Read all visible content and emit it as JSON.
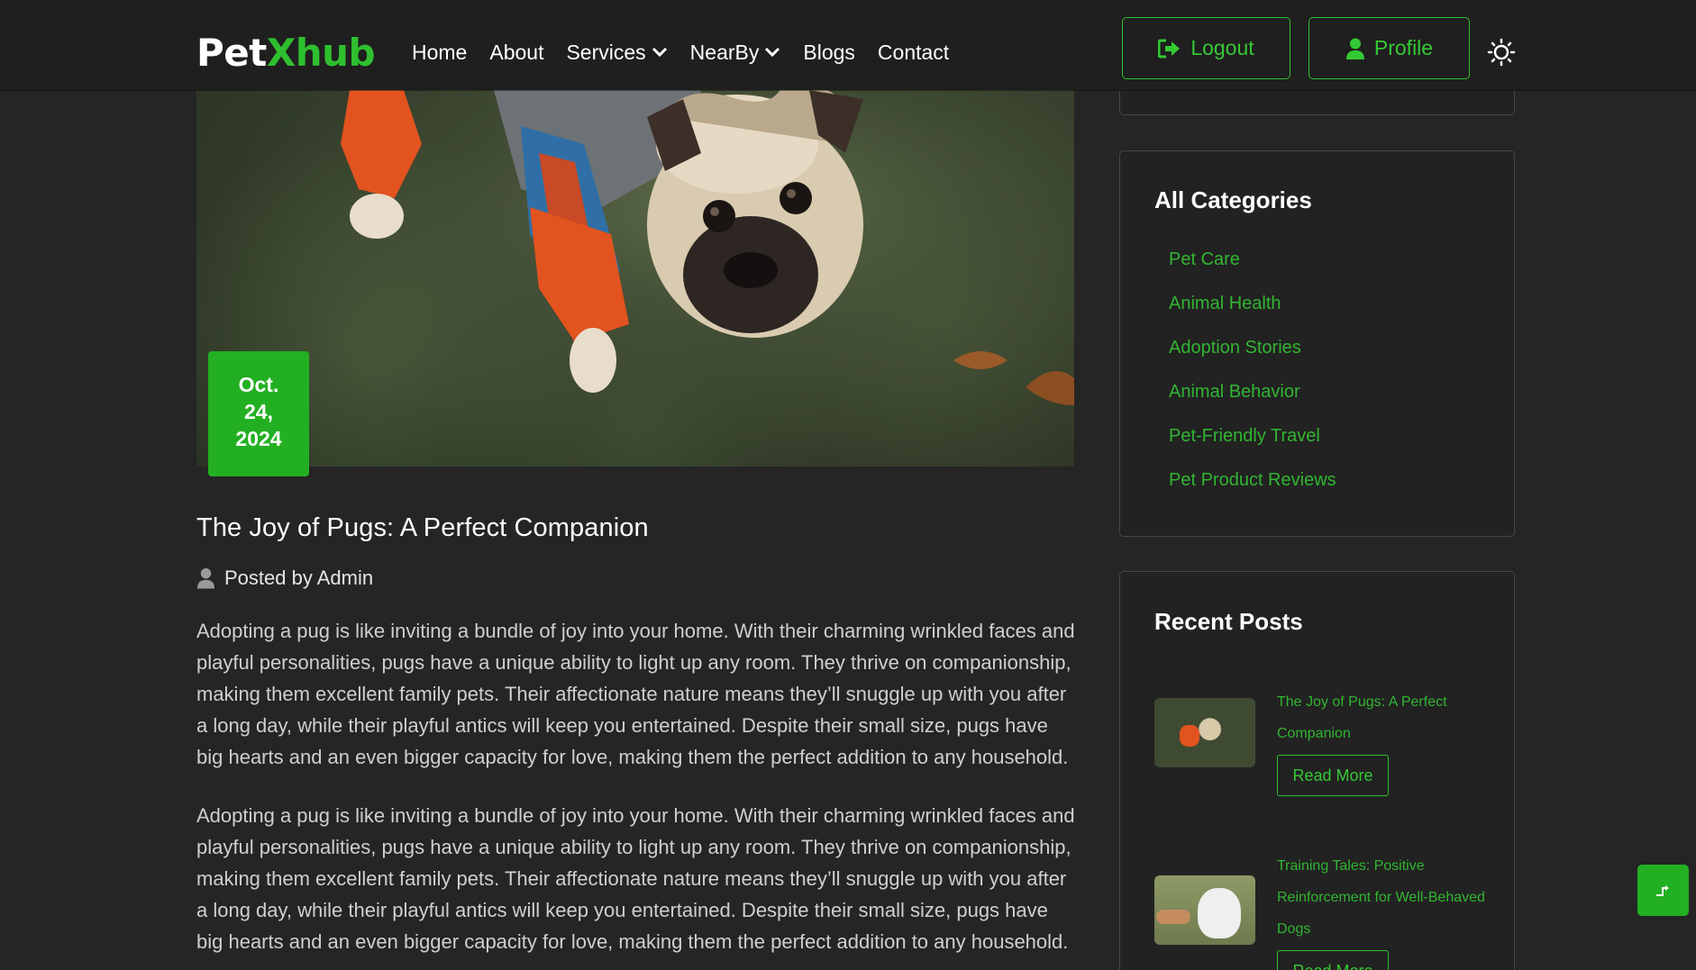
{
  "brand": {
    "part1": "Pet",
    "part2": "Xhub",
    "accent": "#2fbf2f"
  },
  "nav": {
    "items": [
      {
        "label": "Home",
        "dropdown": false
      },
      {
        "label": "About",
        "dropdown": false
      },
      {
        "label": "Services",
        "dropdown": true
      },
      {
        "label": "NearBy",
        "dropdown": true
      },
      {
        "label": "Blogs",
        "dropdown": false
      },
      {
        "label": "Contact",
        "dropdown": false
      }
    ],
    "logout_label": "Logout",
    "profile_label": "Profile",
    "theme_icon": "sun-icon"
  },
  "post": {
    "date_lines": [
      "Oct.",
      "24,",
      "2024"
    ],
    "title": "The Joy of Pugs: A Perfect Companion",
    "author": "Posted by Admin",
    "paragraphs": [
      "Adopting a pug is like inviting a bundle of joy into your home. With their charming wrinkled faces and playful personalities, pugs have a unique ability to light up any room. They thrive on companionship, making them excellent family pets. Their affectionate nature means they’ll snuggle up with you after a long day, while their playful antics will keep you entertained. Despite their small size, pugs have big hearts and an even bigger capacity for love, making them the perfect addition to any household.",
      "Adopting a pug is like inviting a bundle of joy into your home. With their charming wrinkled faces and playful personalities, pugs have a unique ability to light up any room. They thrive on companionship, making them excellent family pets. Their affectionate nature means they’ll snuggle up with you after a long day, while their playful antics will keep you entertained. Despite their small size, pugs have big hearts and an even bigger capacity for love, making them the perfect addition to any household."
    ]
  },
  "sidebar": {
    "categories_title": "All Categories",
    "categories": [
      "Pet Care",
      "Animal Health",
      "Adoption Stories",
      "Animal Behavior",
      "Pet-Friendly Travel",
      "Pet Product Reviews"
    ],
    "recent_title": "Recent Posts",
    "recent_posts": [
      {
        "title": "The Joy of Pugs: A Perfect Companion",
        "button": "Read More"
      },
      {
        "title": "Training Tales: Positive Reinforcement for Well-Behaved Dogs",
        "button": "Read More"
      }
    ]
  },
  "fab": {
    "icon": "scroll-top-icon"
  }
}
